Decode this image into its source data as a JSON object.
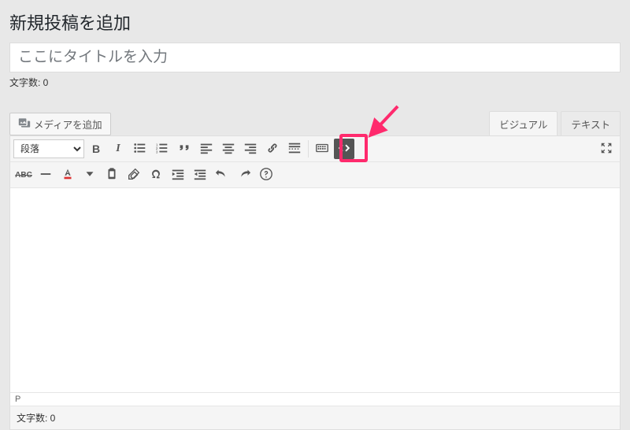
{
  "page_title": "新規投稿を追加",
  "title_placeholder": "ここにタイトルを入力",
  "char_count_label": "文字数: ",
  "char_count_top": "0",
  "media_button_label": "メディアを追加",
  "tabs": {
    "visual": "ビジュアル",
    "text": "テキスト"
  },
  "format_select_value": "段落",
  "path_indicator": "P",
  "char_count_bottom": "0",
  "toolbar_row1": {
    "bold": "B",
    "italic": "I",
    "abc": "ABC"
  },
  "colors": {
    "highlight": "#ff2a6d"
  }
}
